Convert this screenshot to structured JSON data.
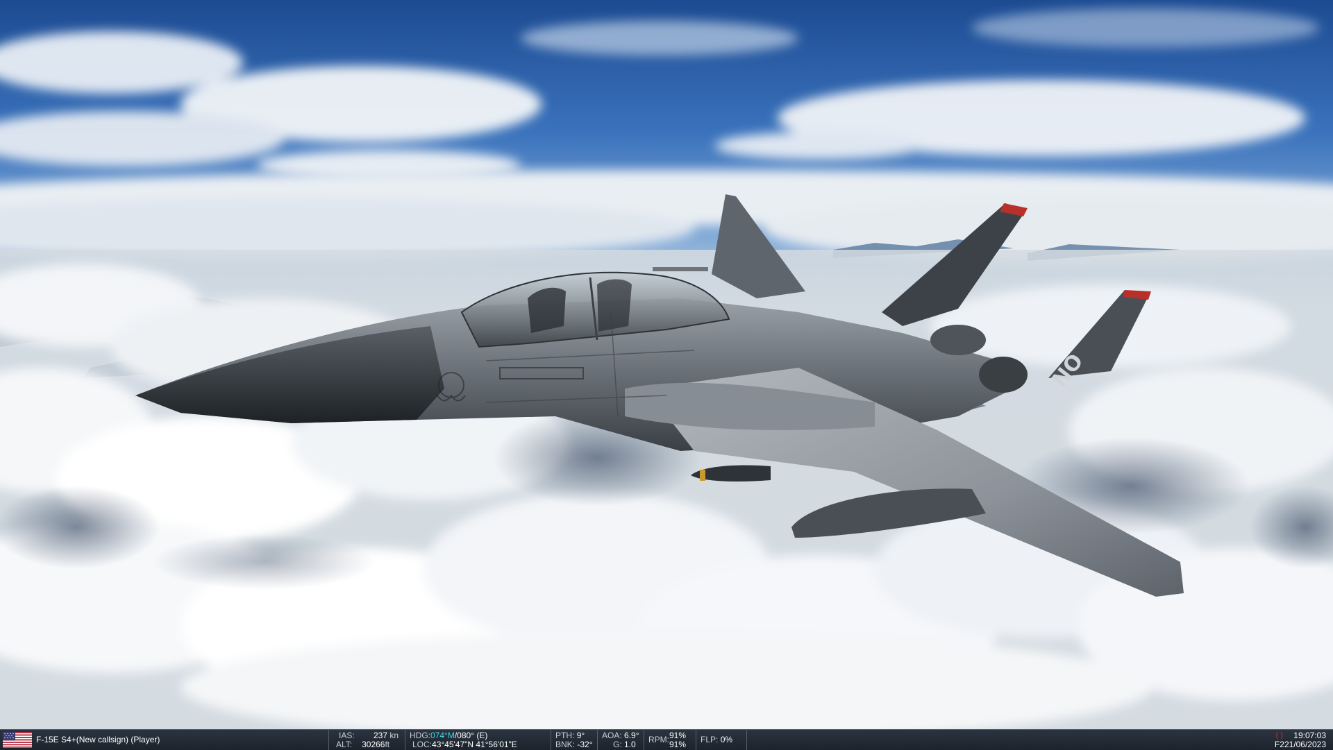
{
  "hud": {
    "unit_label": "F-15E S4+(New callsign) (Player)",
    "ias_label": "IAS:",
    "ias_value": "237",
    "ias_unit": "kn",
    "alt_label": "ALT:",
    "alt_value": "30266",
    "alt_unit": "ft",
    "hdg_label": "HDG:",
    "hdg_magnetic": "074°M",
    "hdg_true": "/080° (E)",
    "loc_label": "LOC:",
    "loc_value": "43°45'47\"N 41°56'01\"E",
    "pth_label": "PTH:",
    "pth_value": "9°",
    "bnk_label": "BNK:",
    "bnk_value": "-32°",
    "aoa_label": "AOA:",
    "aoa_value": "6.9°",
    "g_label": "G:",
    "g_value": "1.0",
    "rpm_label": "RPM:",
    "rpm_value_1": "91%",
    "rpm_value_2": "91%",
    "flp_label": "FLP:",
    "flp_value": "0%",
    "time": "19:07:03",
    "date_prefix": "F2",
    "date": "21/06/2023",
    "bracket": "(  )"
  },
  "aircraft": {
    "tail_code": "NO"
  },
  "colors": {
    "sky_top": "#1f4f96",
    "sky_mid": "#4f86c6",
    "hud_accent": "#3fd6e8",
    "airframe": "#6b7178"
  }
}
